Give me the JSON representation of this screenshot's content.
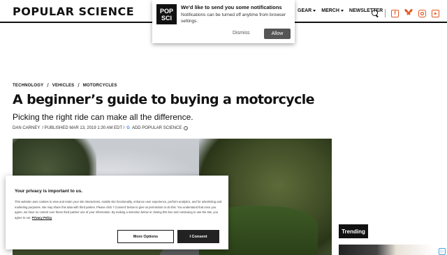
{
  "header": {
    "logo": "POPULAR SCIENCE",
    "nav": [
      {
        "label": "GEAR",
        "has_menu": true
      },
      {
        "label": "MERCH",
        "has_menu": true
      },
      {
        "label": "NEWSLETTER",
        "has_menu": false
      }
    ],
    "icons": [
      "search-icon",
      "flipboard-icon",
      "bluesky-icon",
      "instagram-icon",
      "youtube-icon"
    ]
  },
  "notification": {
    "logo_line1": "POP",
    "logo_line2": "SCI",
    "title": "We'd like to send you some notifications",
    "body": "Notifications can be turned off anytime from browser settings.",
    "dismiss_label": "Dismiss",
    "allow_label": "Allow"
  },
  "article": {
    "breadcrumbs": [
      "TECHNOLOGY",
      "VEHICLES",
      "MOTORCYCLES"
    ],
    "title": "A beginner’s guide to buying a motorcycle",
    "subtitle": "Picking the right ride can make all the difference.",
    "author": "DAN CARNEY",
    "published": "/ PUBLISHED MAR 13, 2019 1:30 AM EDT /",
    "google_label": "ADD POPULAR SCIENCE"
  },
  "sidebar": {
    "trending_label": "Trending"
  },
  "privacy": {
    "title": "Your privacy is important to us.",
    "body": "This website uses cookies to view and retain your site interactions, enable site functionality, enhance user experience, perform analytics, and for advertising and marketing purposes. We may share this data with third parties. Please click 'I Consent' below to give us permission to do this. You understand that once you agree, we have no control over these third parties' use of your information. By making a selection below or closing this box and continuing to use the site, you agree to our:",
    "policy_link": "Privacy Policy",
    "more_options_label": "More Options",
    "consent_label": "I Consent"
  },
  "colors": {
    "brand_dark": "#111111",
    "social_orange": "#e2571f",
    "allow_button": "#555555"
  }
}
